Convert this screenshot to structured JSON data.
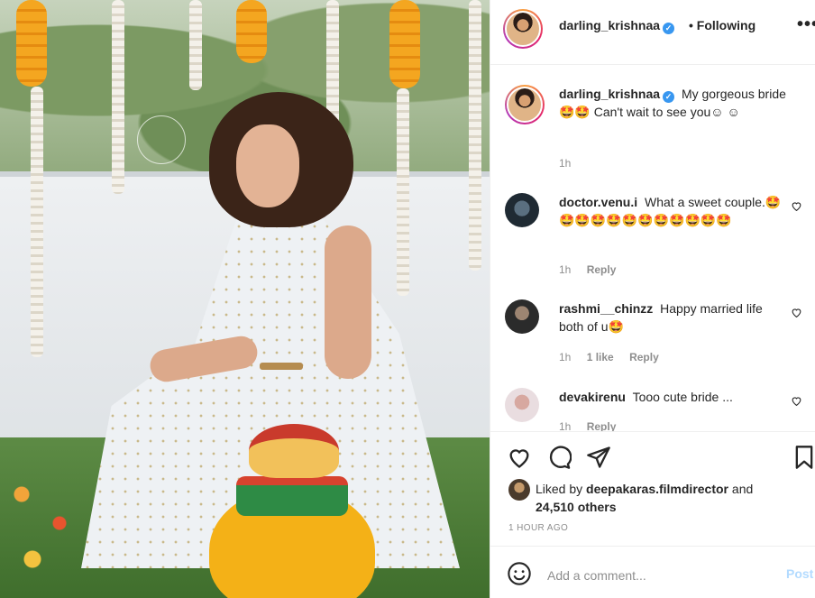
{
  "post": {
    "author": "darling_krishnaa",
    "follow_status": "Following",
    "more_glyph": "•••",
    "verified_glyph": "✓"
  },
  "caption": {
    "username": "darling_krishnaa",
    "text": "My gorgeous bride 🤩🤩 Can't wait to see you☺ ☺",
    "time": "1h"
  },
  "comments": [
    {
      "username": "doctor.venu.i",
      "text": "What a sweet couple.🤩🤩🤩🤩🤩🤩🤩🤩🤩🤩🤩🤩",
      "time": "1h",
      "likes": "",
      "reply": "Reply"
    },
    {
      "username": "rashmi__chinzz",
      "text": "Happy married life both of u🤩",
      "time": "1h",
      "likes": "1 like",
      "reply": "Reply"
    },
    {
      "username": "devakirenu",
      "text": "Tooo cute bride ...",
      "time": "1h",
      "likes": "",
      "reply": "Reply"
    }
  ],
  "likes": {
    "prefix": "Liked by",
    "user": "deepakaras.filmdirector",
    "middle": "and",
    "count": "24,510 others"
  },
  "timestamp": "1 HOUR AGO",
  "composer": {
    "placeholder": "Add a comment...",
    "post_label": "Post"
  },
  "colors": {
    "verified": "#3897f0",
    "post_disabled": "#b3dbff",
    "muted": "#8e8e8e"
  },
  "icons": [
    "heart-icon",
    "comment-icon",
    "share-icon",
    "bookmark-icon",
    "emoji-icon",
    "more-icon"
  ]
}
